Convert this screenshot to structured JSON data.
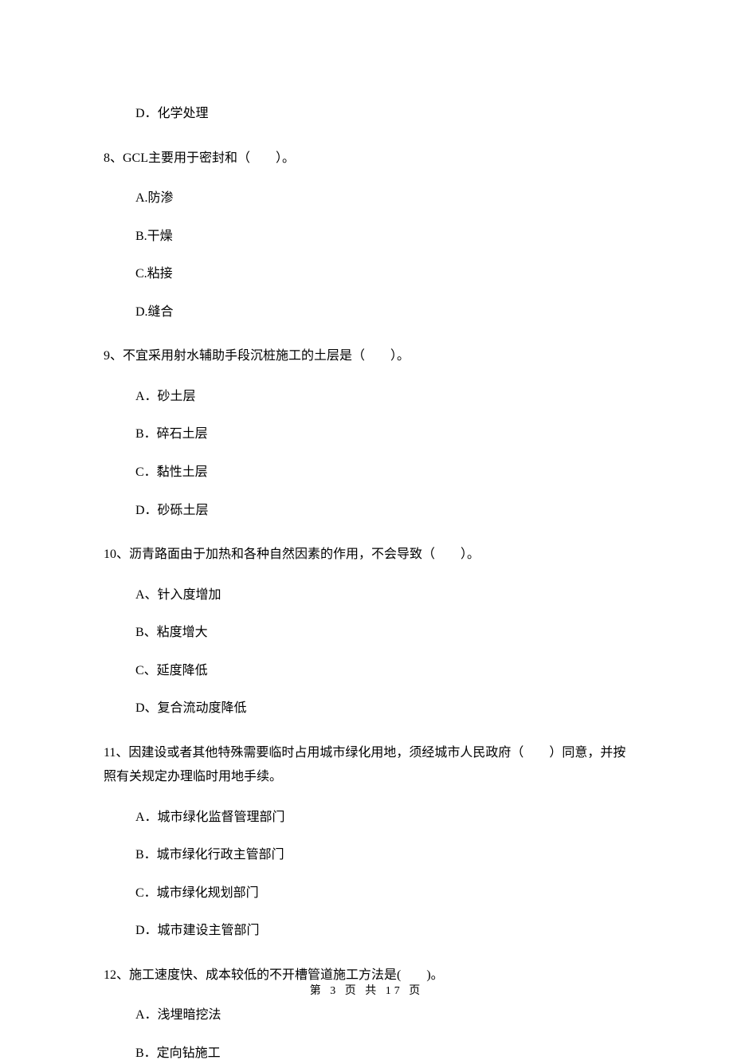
{
  "items": [
    {
      "class": "option",
      "text": "D．化学处理"
    },
    {
      "class": "question",
      "text": "8、GCL主要用于密封和（　　）。"
    },
    {
      "class": "option",
      "text": "A.防渗"
    },
    {
      "class": "option",
      "text": "B.干燥"
    },
    {
      "class": "option",
      "text": "C.粘接"
    },
    {
      "class": "option",
      "text": "D.缝合"
    },
    {
      "class": "question",
      "text": "9、不宜采用射水辅助手段沉桩施工的土层是（　　）。"
    },
    {
      "class": "option",
      "text": "A．砂土层"
    },
    {
      "class": "option",
      "text": "B．碎石土层"
    },
    {
      "class": "option",
      "text": "C．黏性土层"
    },
    {
      "class": "option",
      "text": "D．砂砾土层"
    },
    {
      "class": "question",
      "text": "10、沥青路面由于加热和各种自然因素的作用，不会导致（　　）。"
    },
    {
      "class": "option",
      "text": "A、针入度增加"
    },
    {
      "class": "option",
      "text": "B、粘度增大"
    },
    {
      "class": "option",
      "text": "C、延度降低"
    },
    {
      "class": "option",
      "text": "D、复合流动度降低"
    },
    {
      "class": "question",
      "text": "11、因建设或者其他特殊需要临时占用城市绿化用地，须经城市人民政府（　　）同意，并按照有关规定办理临时用地手续。"
    },
    {
      "class": "option",
      "text": "A．城市绿化监督管理部门"
    },
    {
      "class": "option",
      "text": "B．城市绿化行政主管部门"
    },
    {
      "class": "option",
      "text": "C．城市绿化规划部门"
    },
    {
      "class": "option",
      "text": "D．城市建设主管部门"
    },
    {
      "class": "question",
      "text": "12、施工速度快、成本较低的不开槽管道施工方法是(　　)。"
    },
    {
      "class": "option",
      "text": "A．浅埋暗挖法"
    },
    {
      "class": "option",
      "text": "B．定向钻施工"
    }
  ],
  "footer": "第 3 页 共 17 页"
}
